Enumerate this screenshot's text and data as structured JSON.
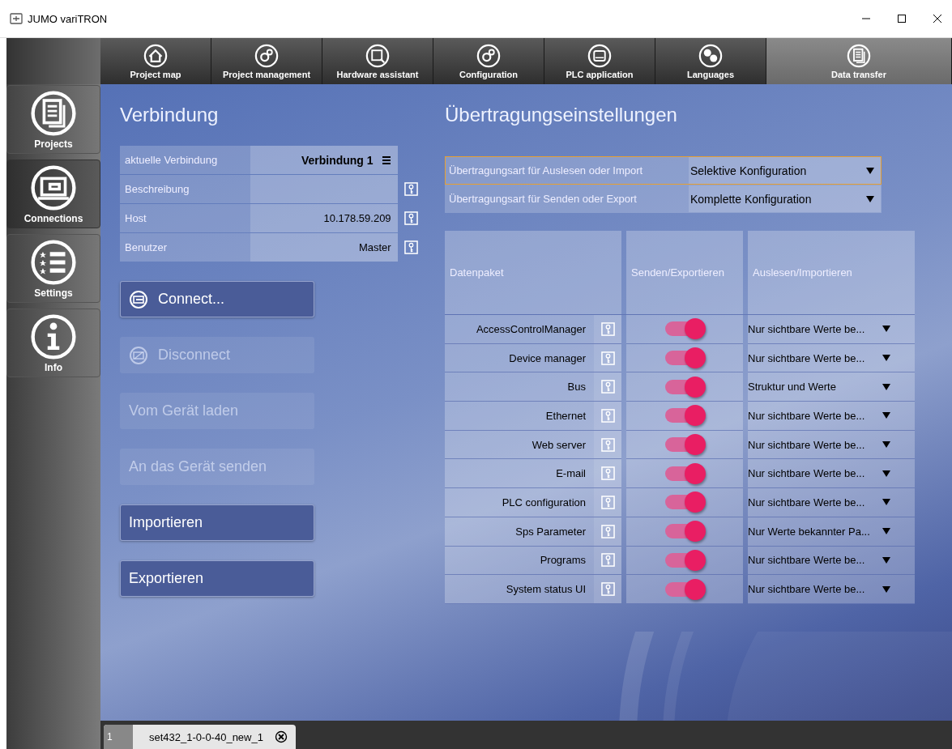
{
  "window": {
    "title": "JUMO variTRON"
  },
  "toolbar": [
    {
      "label": "Project map",
      "selected": false
    },
    {
      "label": "Project management",
      "selected": false
    },
    {
      "label": "Hardware assistant",
      "selected": false
    },
    {
      "label": "Configuration",
      "selected": false
    },
    {
      "label": "PLC application",
      "selected": false
    },
    {
      "label": "Languages",
      "selected": false
    },
    {
      "label": "Data transfer",
      "selected": true
    }
  ],
  "sidebar": [
    {
      "label": "Projects",
      "selected": false
    },
    {
      "label": "Connections",
      "selected": true
    },
    {
      "label": "Settings",
      "selected": false
    },
    {
      "label": "Info",
      "selected": false
    }
  ],
  "connection": {
    "heading": "Verbindung",
    "rows": [
      {
        "label": "aktuelle Verbindung",
        "value": "Verbindung 1",
        "kind": "menu"
      },
      {
        "label": "Beschreibung",
        "kind": "key"
      },
      {
        "label": "Host",
        "value": "10.178.59.209",
        "kind": "key"
      },
      {
        "label": "Benutzer",
        "value": "Master",
        "kind": "key"
      }
    ]
  },
  "buttons": [
    {
      "label": "Connect...",
      "kind": "connect",
      "disabled": false
    },
    {
      "label": "Disconnect",
      "kind": "disconnect",
      "disabled": true
    },
    {
      "label": "Vom Gerät laden",
      "kind": "plain",
      "disabled": true
    },
    {
      "label": "An das Gerät senden",
      "kind": "plain",
      "disabled": true
    },
    {
      "label": "Importieren",
      "kind": "plain",
      "disabled": false
    },
    {
      "label": "Exportieren",
      "kind": "plain",
      "disabled": false
    }
  ],
  "transfer": {
    "heading": "Übertragungseinstellungen",
    "settings": [
      {
        "label": "Übertragungsart für Auslesen oder Import",
        "value": "Selektive Konfiguration",
        "focused": true
      },
      {
        "label": "Übertragungsart für Senden oder Export",
        "value": "Komplette Konfiguration",
        "focused": false
      }
    ],
    "columns": [
      "Datenpaket",
      "Senden/Exportieren",
      "Auslesen/Importieren"
    ],
    "rows": [
      {
        "name": "AccessControlManager",
        "on": true,
        "mode": "Nur sichtbare Werte be..."
      },
      {
        "name": "Device manager",
        "on": true,
        "mode": "Nur sichtbare Werte be..."
      },
      {
        "name": "Bus",
        "on": true,
        "mode": "Struktur und Werte"
      },
      {
        "name": "Ethernet",
        "on": true,
        "mode": "Nur sichtbare Werte be..."
      },
      {
        "name": "Web server",
        "on": true,
        "mode": "Nur sichtbare Werte be..."
      },
      {
        "name": "E-mail",
        "on": true,
        "mode": "Nur sichtbare Werte be..."
      },
      {
        "name": "PLC configuration",
        "on": true,
        "mode": "Nur sichtbare Werte be..."
      },
      {
        "name": "Sps Parameter",
        "on": true,
        "mode": "Nur Werte bekannter Pa..."
      },
      {
        "name": "Programs",
        "on": true,
        "mode": "Nur sichtbare Werte be..."
      },
      {
        "name": "System status UI",
        "on": true,
        "mode": "Nur sichtbare Werte be..."
      }
    ]
  },
  "file_tabs": [
    {
      "number": "1",
      "name": "set432_1-0-0-40_new_1"
    }
  ]
}
